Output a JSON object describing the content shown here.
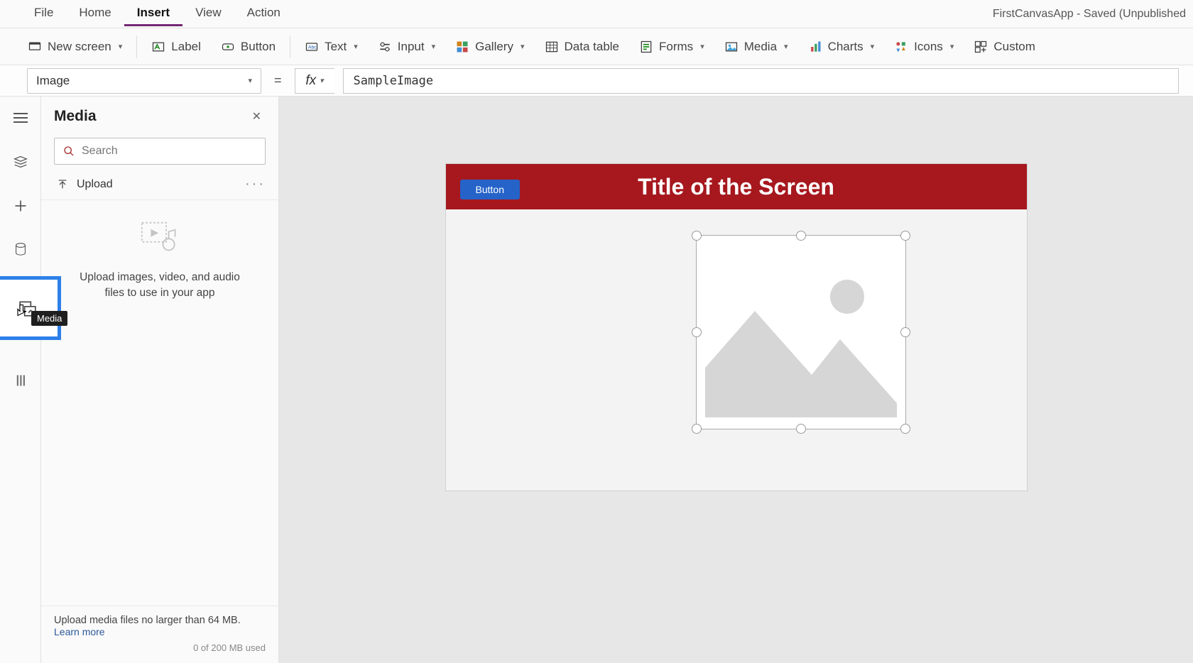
{
  "menu": {
    "items": [
      "File",
      "Home",
      "Insert",
      "View",
      "Action"
    ],
    "active_index": 2
  },
  "app_title": "FirstCanvasApp - Saved (Unpublished",
  "ribbon": {
    "new_screen": "New screen",
    "label": "Label",
    "button": "Button",
    "text": "Text",
    "input": "Input",
    "gallery": "Gallery",
    "data_table": "Data table",
    "forms": "Forms",
    "media": "Media",
    "charts": "Charts",
    "icons": "Icons",
    "custom": "Custom"
  },
  "formula": {
    "property": "Image",
    "value": "SampleImage"
  },
  "panel": {
    "title": "Media",
    "search_placeholder": "Search",
    "upload": "Upload",
    "hint": "Upload images, video, and audio files to use in your app",
    "footer_line": "Upload media files no larger than 64 MB.",
    "learn_more": "Learn more",
    "usage": "0 of 200 MB used"
  },
  "sidebar_tooltip": "Media",
  "canvas": {
    "header_button": "Button",
    "header_title": "Title of the Screen"
  }
}
